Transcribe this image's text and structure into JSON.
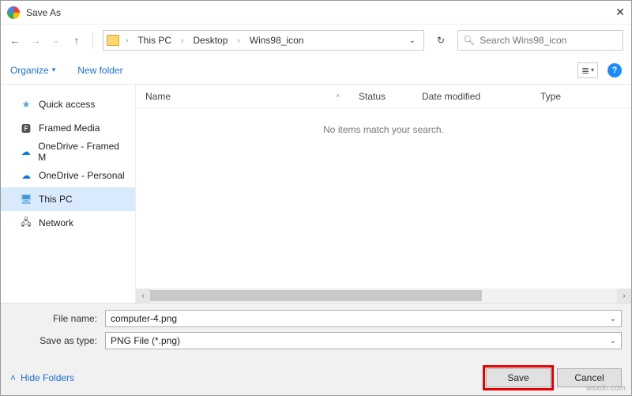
{
  "title": "Save As",
  "breadcrumb": {
    "root": "This PC",
    "p1": "Desktop",
    "p2": "Wins98_icon"
  },
  "search": {
    "placeholder": "Search Wins98_icon"
  },
  "toolbar": {
    "organize": "Organize",
    "newfolder": "New folder"
  },
  "sidebar": {
    "quick": "Quick access",
    "framed": "Framed Media",
    "od_framed": "OneDrive - Framed M",
    "od_personal": "OneDrive - Personal",
    "thispc": "This PC",
    "network": "Network"
  },
  "columns": {
    "name": "Name",
    "status": "Status",
    "date": "Date modified",
    "type": "Type"
  },
  "empty_msg": "No items match your search.",
  "labels": {
    "filename": "File name:",
    "savetype": "Save as type:"
  },
  "values": {
    "filename": "computer-4.png",
    "savetype": "PNG File (*.png)"
  },
  "actions": {
    "hide": "Hide Folders",
    "save": "Save",
    "cancel": "Cancel"
  },
  "watermark": "wsxdn.com"
}
